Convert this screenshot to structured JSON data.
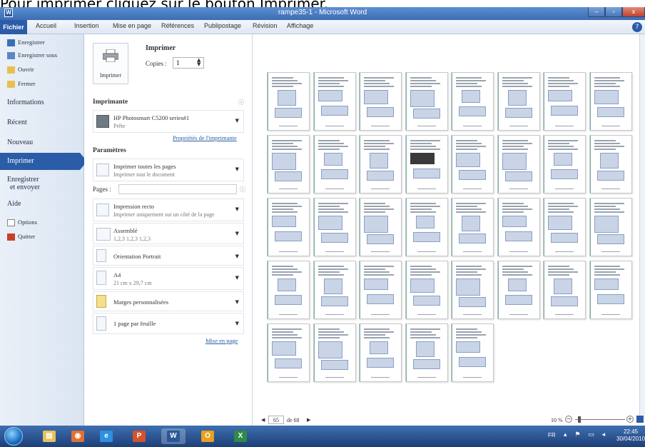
{
  "caption": "Pour imprimer cliquez sur le bouton Imprimer.",
  "window": {
    "title": "rampe35-1 - Microsoft Word",
    "app_letter": "W",
    "min": "–",
    "max": "▫",
    "close": "x"
  },
  "ribbon": {
    "tabs": [
      "Fichier",
      "Accueil",
      "Insertion",
      "Mise en page",
      "Références",
      "Publipostage",
      "Révision",
      "Affichage"
    ],
    "help": "?"
  },
  "nav": {
    "save": "Enregistrer",
    "save_as": "Enregistrer sous",
    "open": "Ouvrir",
    "close": "Fermer",
    "info": "Informations",
    "recent": "Récent",
    "new": "Nouveau",
    "print": "Imprimer",
    "send_1": "Enregistrer",
    "send_2": "et envoyer",
    "help": "Aide",
    "options": "Options",
    "quit": "Quitter"
  },
  "print_panel": {
    "button_label": "Imprimer",
    "title": "Imprimer",
    "copies_label": "Copies :",
    "copies_value": "1",
    "printer_head": "Imprimante",
    "printer_name": "HP Photosmart C5200 series#1",
    "printer_status": "Prête",
    "printer_props": "Propriétés de l'imprimante",
    "params_head": "Paramètres",
    "range_main": "Imprimer toutes les pages",
    "range_sub": "Imprimer tout le document",
    "pages_label": "Pages :",
    "pages_value": "",
    "sides_main": "Impression recto",
    "sides_sub": "Imprimer uniquement sur un côté de la page",
    "collate_main": "Assemblé",
    "collate_sub": "1,2,3   1,2,3   1,2,3",
    "orientation": "Orientation Portrait",
    "paper_main": "A4",
    "paper_sub": "21 cm x 29,7 cm",
    "margins": "Marges personnalisées",
    "per_sheet": "1 page par feuille",
    "page_setup": "Mise en page"
  },
  "status": {
    "current_page": "65",
    "total": "de 68",
    "zoom": "10 %"
  },
  "tray": {
    "lang": "FR",
    "time": "22:45",
    "date": "30/04/2010"
  },
  "taskbar_apps": [
    {
      "name": "explorer",
      "glyph": "▤",
      "color": "#e6c25a"
    },
    {
      "name": "media",
      "glyph": "◉",
      "color": "#e07030"
    },
    {
      "name": "ie",
      "glyph": "e",
      "color": "#2f8fe0"
    },
    {
      "name": "powerpoint",
      "glyph": "P",
      "color": "#d4532a"
    },
    {
      "name": "word",
      "glyph": "W",
      "color": "#2b579a"
    },
    {
      "name": "outlook",
      "glyph": "O",
      "color": "#e8a020"
    },
    {
      "name": "excel",
      "glyph": "X",
      "color": "#2e8b45"
    }
  ]
}
